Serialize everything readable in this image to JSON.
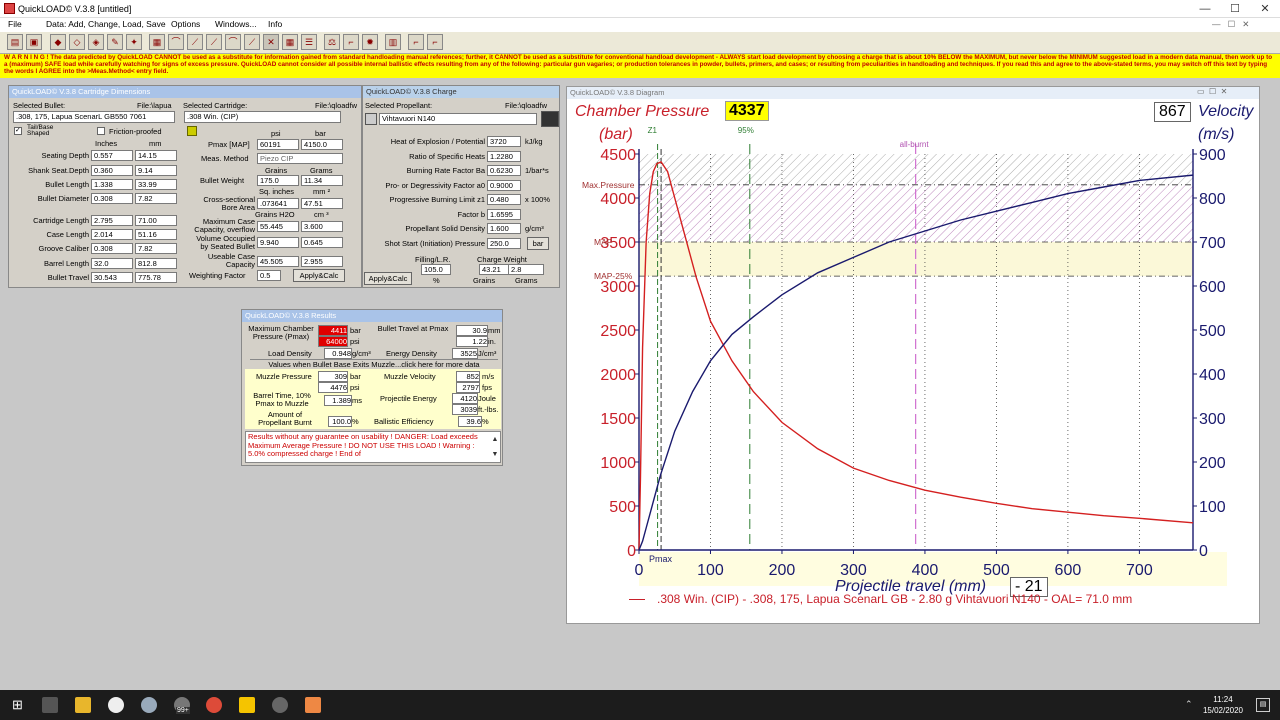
{
  "app": {
    "title": "QuickLOAD© V.3.8  [untitled]"
  },
  "menu": [
    "File",
    "Data: Add, Change, Load, Save",
    "Options",
    "Windows...",
    "Info"
  ],
  "warning": "W A R N I N G ! The data predicted by QuickLOAD CANNOT be used as a substitute for information gained from standard handloading manual references; further, it CANNOT be used as a substitute for conventional handload development - ALWAYS start load development by choosing a charge that is about 10% BELOW the MAXIMUM, but never below the MINIMUM suggested load in a modern data manual, then work up to a (maximum) SAFE load while carefully watching for signs of excess pressure. QuickLOAD cannot consider all possible internal ballistic effects resulting from any of the following: particular gun vagaries; or production tolerances in powder, bullets, primers, and cases; or resulting from peculiarities in handloading and techniques. If you read this and agree to the above-stated terms, you may switch off this text by typing the words I AGREE into the >Meas.Method< entry field.",
  "dims": {
    "title": "QuickLOAD© V.3.8 Cartridge Dimensions",
    "sel_bullet": "Selected Bullet:",
    "file_bullet": "File:\\lapua",
    "sel_cart": "Selected Cartridge:",
    "file_cart": "File:\\qloadfw",
    "bullet": ".308, 175, Lapua ScenarL GB550 7061",
    "cartridge": ".308 Win. (CIP)",
    "tailbase": "Tail/Base Shaped",
    "friction": "Friction-proofed",
    "hdr_in": "Inches",
    "hdr_mm": "mm",
    "rows": [
      {
        "label": "Seating Depth",
        "in": "0.557",
        "mm": "14.15"
      },
      {
        "label": "Shank Seat.Depth",
        "in": "0.360",
        "mm": "9.14"
      },
      {
        "label": "Bullet Length",
        "in": "1.338",
        "mm": "33.99"
      },
      {
        "label": "Bullet Diameter",
        "in": "0.308",
        "mm": "7.82"
      },
      {
        "label": "Cartridge Length",
        "in": "2.795",
        "mm": "71.00"
      },
      {
        "label": "Case Length",
        "in": "2.014",
        "mm": "51.16"
      },
      {
        "label": "Groove Caliber",
        "in": "0.308",
        "mm": "7.82"
      },
      {
        "label": "Barrel Length",
        "in": "32.0",
        "mm": "812.8"
      },
      {
        "label": "Bullet Travel",
        "in": "30.543",
        "mm": "775.78"
      }
    ],
    "psi": "psi",
    "bar": "bar",
    "pmax_label": "Pmax [MAP]",
    "pmax_psi": "60191",
    "pmax_bar": "4150.0",
    "meas_label": "Meas. Method",
    "meas_val": "Piezo CIP",
    "grains": "Grains",
    "grams": "Grams",
    "bw_label": "Bullet Weight",
    "bw_gr": "175.0",
    "bw_g": "11.34",
    "sq_in": "Sq. inches",
    "mm2": "mm ²",
    "cs_label": "Cross-sectional Bore Area",
    "cs_in": ".073641",
    "cs_mm": "47.51",
    "grh2o": "Grains H2O",
    "cm3": "cm ³",
    "mc_label": "Maximum Case Capacity, overflow",
    "mc_gr": "55.445",
    "mc_cm": "3.600",
    "vol_label": "Volume Occupied by Seated Bullet",
    "vol_gr": "9.940",
    "vol_cm": "0.645",
    "uc_label": "Useable Case Capacity",
    "uc_gr": "45.505",
    "uc_cm": "2.955",
    "wf_label": "Weighting Factor",
    "wf_val": "0.5",
    "apply": "Apply&Calc"
  },
  "charge": {
    "title": "QuickLOAD© V.3.8 Charge",
    "sel_prop": "Selected Propellant:",
    "file": "File:\\qloadfw",
    "prop": "Vihtavuori N140",
    "rows": [
      {
        "label": "Heat of Explosion / Potential",
        "val": "3720",
        "unit": "kJ/kg"
      },
      {
        "label": "Ratio of Specific Heats",
        "val": "1.2280",
        "unit": ""
      },
      {
        "label": "Burning Rate Factor  Ba",
        "val": "0.6230",
        "unit": "1/bar*s"
      },
      {
        "label": "Pro- or Degressivity Factor  a0",
        "val": "0.9000",
        "unit": ""
      },
      {
        "label": "Progressive Burning Limit z1",
        "val": "0.480",
        "unit": "x 100%"
      },
      {
        "label": "Factor  b",
        "val": "1.6595",
        "unit": ""
      },
      {
        "label": "Propellant Solid Density",
        "val": "1.600",
        "unit": "g/cm³"
      },
      {
        "label": "Shot Start (Initiation) Pressure",
        "val": "250.0",
        "unit": "bar"
      }
    ],
    "filling_label": "Filling/L.R.",
    "charge_label": "Charge Weight",
    "filling": "105.0",
    "pct": "%",
    "cw_gr": "43.21",
    "cw_g": "2.8",
    "grains": "Grains",
    "grams": "Grams",
    "apply": "Apply&Calc"
  },
  "results": {
    "title": "QuickLOAD© V.3.8 Results",
    "mcp_label": "Maximum Chamber Pressure (Pmax)",
    "mcp_bar": "4411",
    "mcp_psi": "64000",
    "bar": "bar",
    "psi": "psi",
    "bt_label": "Bullet Travel at Pmax",
    "bt_mm": "30.9",
    "bt_in": "1.22",
    "mm": "mm",
    "in": "in.",
    "ld_label": "Load Density",
    "ld_val": "0.948",
    "ld_unit": "g/cm³",
    "ed_label": "Energy Density",
    "ed_val": "3525",
    "ed_unit": "J/cm³",
    "sep": "Values when Bullet Base Exits Muzzle...click here for more data",
    "mp_label": "Muzzle Pressure",
    "mp_bar": "309",
    "mp_psi": "4476",
    "mv_label": "Muzzle Velocity",
    "mv_ms": "852",
    "mv_fps": "2797",
    "ms": "m/s",
    "fps": "fps",
    "bt2_label": "Barrel Time, 10% Pmax to Muzzle",
    "bt2_val": "1.389",
    "bt2_unit": "ms",
    "pe_label": "Projectile Energy",
    "pe_j": "4120",
    "pe_ft": "3039",
    "joule": "Joule",
    "ftlbs": "ft.-lbs.",
    "ab_label": "Amount of Propellant Burnt",
    "ab_val": "100.0",
    "ab_unit": "%",
    "be_label": "Ballistic Efficiency",
    "be_val": "39.6",
    "be_unit": "%",
    "msg": "Results without any guarantee on usability !  DANGER: Load exceeds Maximum Average Pressure ! DO NOT USE THIS LOAD !   Warning : 5.0% compressed charge !  End of"
  },
  "diagram": {
    "title": "QuickLOAD© V.3.8 Diagram",
    "cp_label": "Chamber Pressure",
    "cp_val": "4337",
    "bar_label": "(bar)",
    "v_val": "867",
    "v_label": "Velocity",
    "ms_label": "(m/s)",
    "xlabel": "Projectile travel (mm)",
    "x_val": "- 21",
    "z1": "Z1",
    "p95": "95%",
    "allburnt": "all-burnt",
    "maxp": "Max.Pressure",
    "map": "MAP",
    "map25": "MAP-25%",
    "pmax": "Pmax",
    "legend": ".308 Win. (CIP) - .308, 175, Lapua ScenarL GB - 2.80 g Vihtavuori N140 - OAL= 71.0 mm",
    "colors": {
      "pressure": "#d42020",
      "velocity": "#1a1a6e"
    }
  },
  "chart_data": {
    "type": "line",
    "xlabel": "Projectile travel (mm)",
    "ylabel": "Chamber Pressure (bar)",
    "y2label": "Velocity (m/s)",
    "xlim": [
      0,
      775
    ],
    "ylim": [
      0,
      4500
    ],
    "y2lim": [
      0,
      900
    ],
    "xticks": [
      0,
      100,
      200,
      300,
      400,
      500,
      600,
      700
    ],
    "yticks": [
      0,
      500,
      1000,
      1500,
      2000,
      2500,
      3000,
      3500,
      4000,
      4500
    ],
    "y2ticks": [
      0,
      100,
      200,
      300,
      400,
      500,
      600,
      700,
      800,
      900
    ],
    "series": [
      {
        "name": "Chamber Pressure",
        "axis": "left",
        "x": [
          0,
          2,
          5,
          10,
          15,
          20,
          25,
          30.9,
          40,
          50,
          60,
          80,
          100,
          130,
          160,
          200,
          250,
          300,
          350,
          400,
          450,
          500,
          550,
          600,
          650,
          700,
          775
        ],
        "y": [
          0,
          800,
          2300,
          3500,
          4050,
          4300,
          4390,
          4411,
          4300,
          4000,
          3700,
          3100,
          2600,
          2150,
          1800,
          1450,
          1150,
          930,
          790,
          680,
          600,
          530,
          470,
          430,
          390,
          360,
          309
        ]
      },
      {
        "name": "Velocity",
        "axis": "right",
        "x": [
          0,
          5,
          10,
          20,
          30,
          40,
          50,
          75,
          100,
          130,
          160,
          200,
          250,
          300,
          350,
          400,
          450,
          500,
          550,
          600,
          650,
          700,
          775
        ],
        "y": [
          0,
          20,
          50,
          110,
          170,
          220,
          270,
          360,
          430,
          490,
          530,
          580,
          630,
          665,
          700,
          725,
          750,
          770,
          790,
          810,
          825,
          840,
          852
        ]
      }
    ],
    "lines": [
      {
        "label": "Max.Pressure",
        "y": 4150
      },
      {
        "label": "MAP",
        "y": 3500
      },
      {
        "label": "MAP-25%",
        "y": 3112
      },
      {
        "label": "Z1",
        "x": 26
      },
      {
        "label": "95%",
        "x": 155
      },
      {
        "label": "all-burnt",
        "x": 387
      }
    ]
  },
  "taskbar": {
    "time": "11:24",
    "date": "15/02/2020",
    "badge": "99+"
  }
}
